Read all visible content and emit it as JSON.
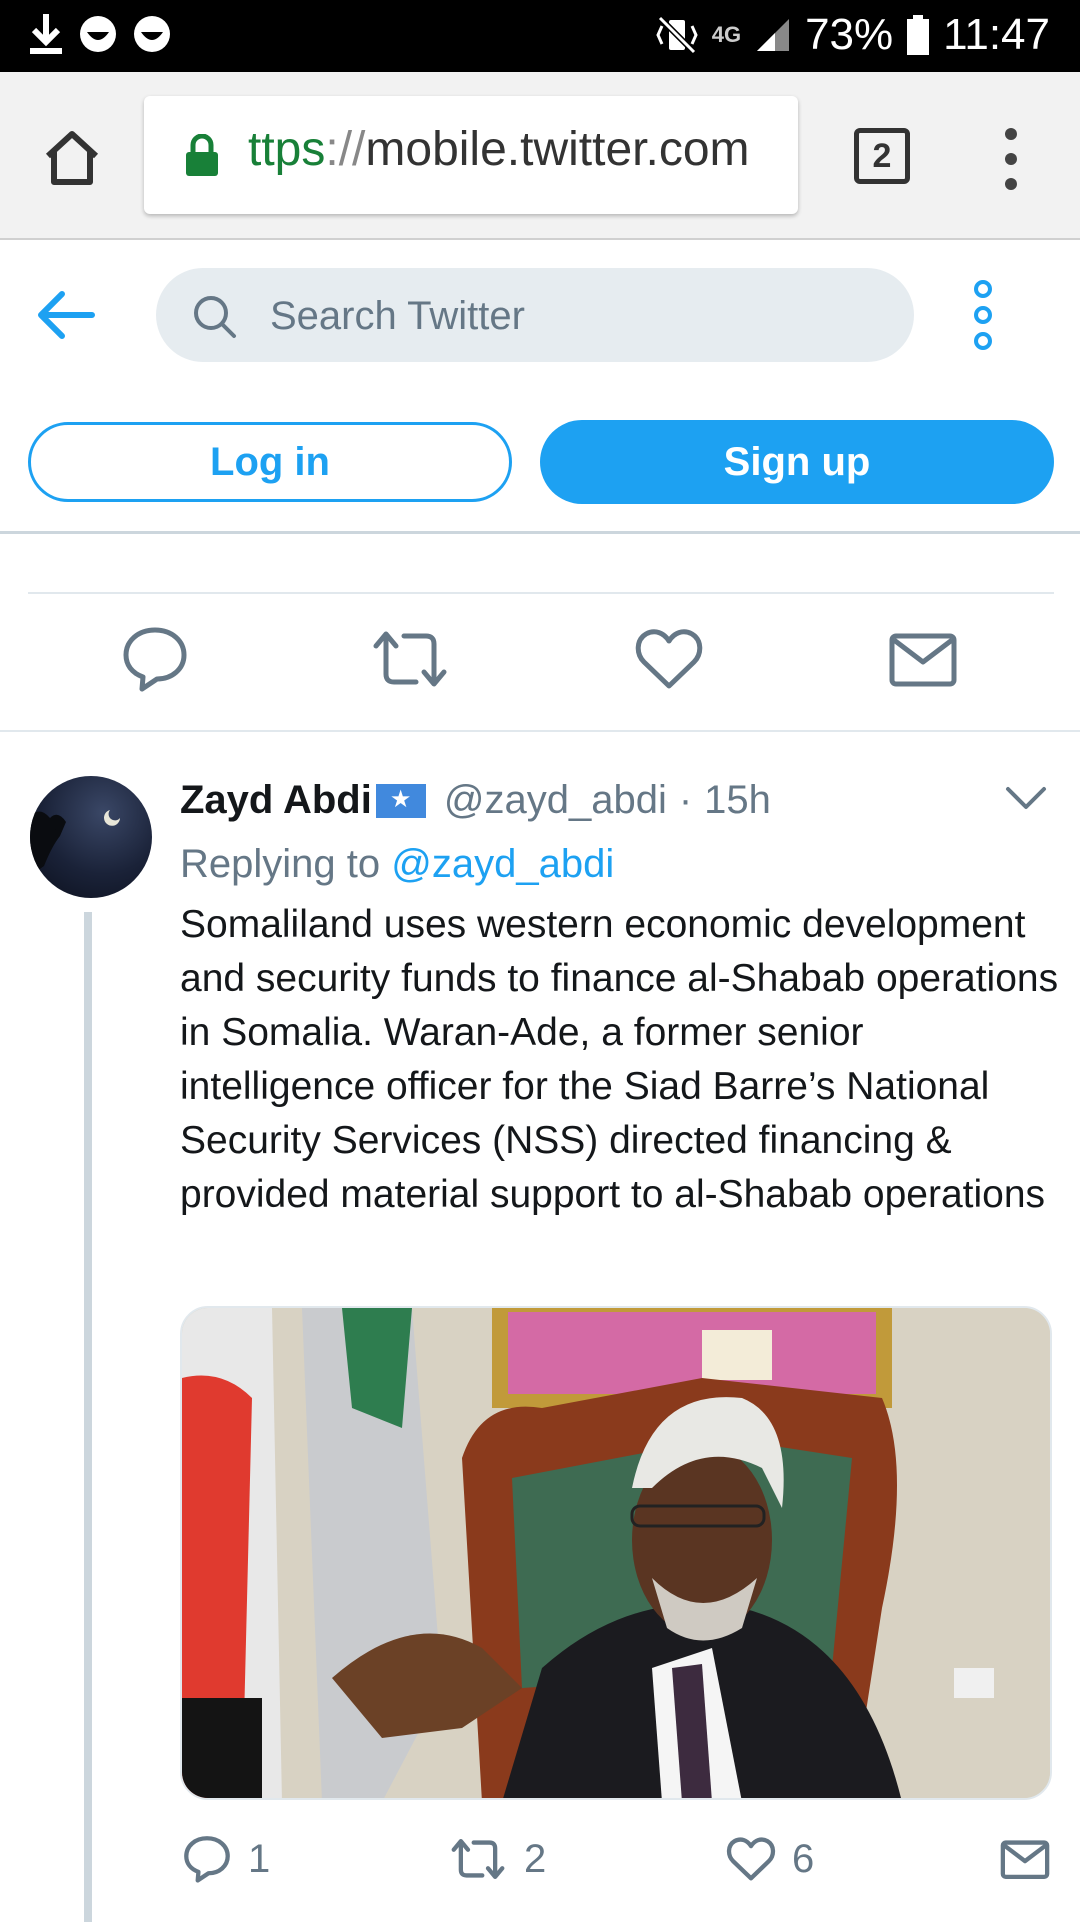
{
  "status_bar": {
    "signal": "4G",
    "battery": "73%",
    "time": "11:47"
  },
  "browser": {
    "url_scheme": "ttps",
    "url_sep": "://",
    "url_host": "mobile.twitter.com",
    "tab_count": "2"
  },
  "twitter_header": {
    "search_placeholder": "Search Twitter",
    "login_label": "Log in",
    "signup_label": "Sign up"
  },
  "tweet": {
    "name": "Zayd Abdi",
    "handle": "@zayd_abdi",
    "dot": "·",
    "time": "15h",
    "replying_label": "Replying to",
    "replying_mention": "@zayd_abdi",
    "body": "Somaliland uses western economic development and security funds to finance al-Shabab operations in Somalia. Waran-Ade, a former senior intelligence officer for the Siad Barre’s National Security Services (NSS) directed financing & provided material support to al-Shabab operations",
    "reply_count": "1",
    "retweet_count": "2",
    "like_count": "6"
  },
  "colors": {
    "accent": "#1da1f2",
    "muted": "#657786",
    "border": "#e1e8ed"
  }
}
